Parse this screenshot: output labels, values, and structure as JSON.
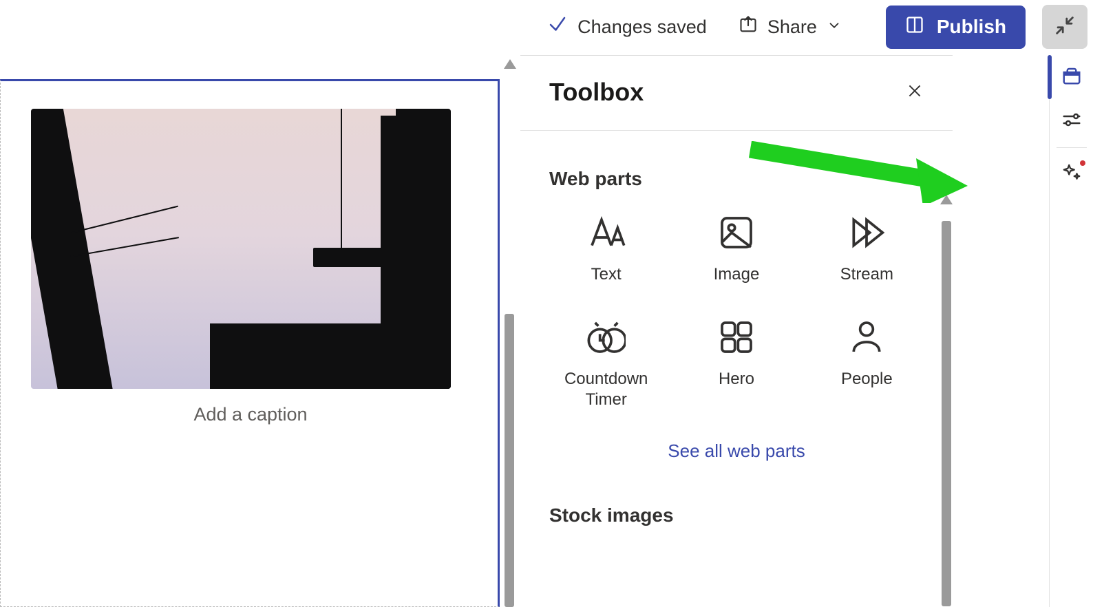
{
  "topbar": {
    "status_label": "Changes saved",
    "share_label": "Share",
    "publish_label": "Publish"
  },
  "canvas": {
    "caption_placeholder": "Add a caption"
  },
  "panel": {
    "title": "Toolbox",
    "section_webparts": "Web parts",
    "see_all_label": "See all web parts",
    "section_stock": "Stock images",
    "webparts": [
      {
        "label": "Text",
        "icon": "text-icon"
      },
      {
        "label": "Image",
        "icon": "image-icon"
      },
      {
        "label": "Stream",
        "icon": "stream-icon"
      },
      {
        "label": "Countdown Timer",
        "icon": "countdown-timer-icon"
      },
      {
        "label": "Hero",
        "icon": "hero-icon"
      },
      {
        "label": "People",
        "icon": "people-icon"
      }
    ]
  },
  "rail": {
    "items": [
      {
        "name": "toolbox-tab",
        "icon": "toolbox-icon",
        "active": true
      },
      {
        "name": "settings-tab",
        "icon": "sliders-icon"
      },
      {
        "name": "ai-tab",
        "icon": "sparkle-icon",
        "badge": true
      }
    ]
  }
}
